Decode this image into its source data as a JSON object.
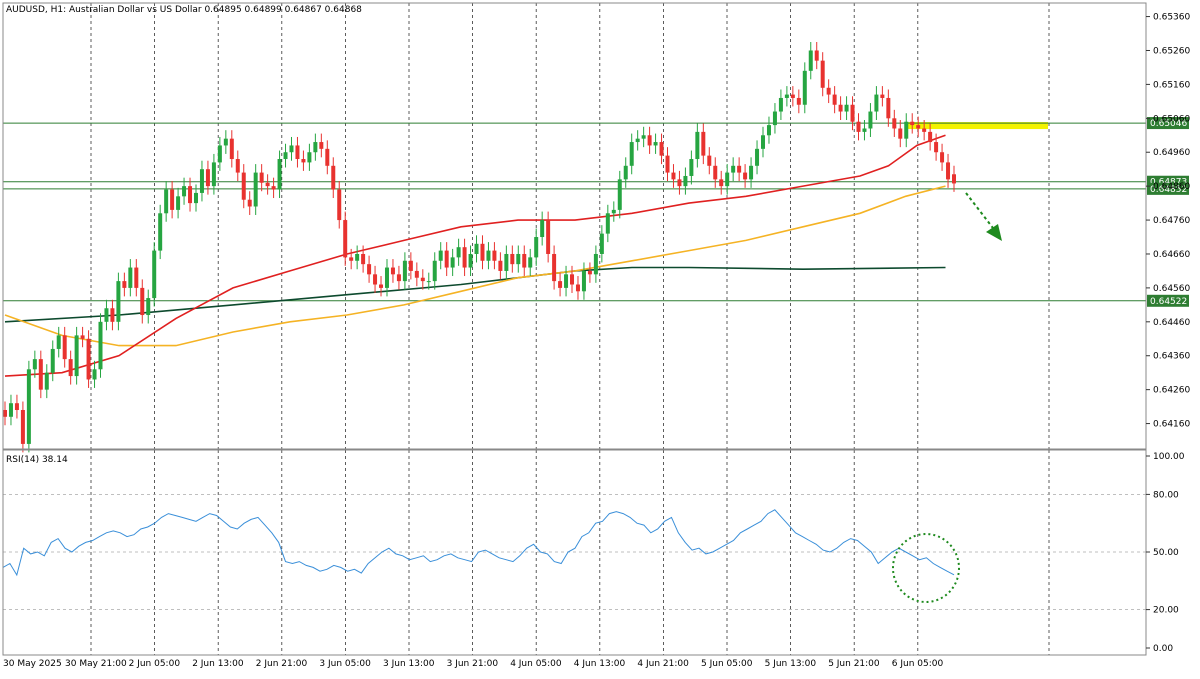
{
  "header": {
    "title": "AUDUSD, H1:  Australian Dollar vs US Dollar  0.64895 0.64899 0.64867 0.64868"
  },
  "rsi_panel": {
    "label": "RSI(14) 38.14"
  },
  "colors": {
    "bull": "#26a541",
    "bear": "#e8322f",
    "ma_red": "#e02020",
    "ma_orange": "#f5b324",
    "ma_dark": "#0d4a2e",
    "rsi": "#3a8fd9",
    "level_line": "#2e7d32",
    "highlight": "#f2f200",
    "price_label_bg": "#2e7d32",
    "arrow": "#1e8a1e"
  },
  "chart_data": {
    "type": "candlestick",
    "symbol": "AUDUSD",
    "timeframe": "H1",
    "ohlc_last": [
      0.64895,
      0.64899,
      0.64867,
      0.64868
    ],
    "y_ticks": [
      "0.65360",
      "0.65260",
      "0.65160",
      "0.65060",
      "0.64960",
      "0.64860",
      "0.64760",
      "0.64660",
      "0.64560",
      "0.64460",
      "0.64360",
      "0.64260",
      "0.64160"
    ],
    "y_range": [
      0.64085,
      0.654
    ],
    "x_labels": [
      "30 May 2025",
      "30 May 21:00",
      "2 Jun 05:00",
      "2 Jun 13:00",
      "2 Jun 21:00",
      "3 Jun 05:00",
      "3 Jun 13:00",
      "3 Jun 21:00",
      "4 Jun 05:00",
      "4 Jun 13:00",
      "4 Jun 21:00",
      "5 Jun 05:00",
      "5 Jun 13:00",
      "5 Jun 21:00",
      "6 Jun 05:00"
    ],
    "x_label_bars": [
      0,
      8,
      16,
      24,
      32,
      40,
      48,
      56,
      64,
      72,
      80,
      88,
      96,
      104,
      112
    ],
    "closes": [
      0.6418,
      0.6422,
      0.642,
      0.641,
      0.6432,
      0.6435,
      0.6426,
      0.6431,
      0.6438,
      0.6442,
      0.6435,
      0.643,
      0.6442,
      0.6441,
      0.6429,
      0.6432,
      0.6446,
      0.645,
      0.6446,
      0.6458,
      0.6456,
      0.6462,
      0.6456,
      0.6448,
      0.6453,
      0.6467,
      0.6478,
      0.6485,
      0.6479,
      0.6483,
      0.6486,
      0.6481,
      0.6484,
      0.6491,
      0.6486,
      0.6493,
      0.6498,
      0.65,
      0.6494,
      0.649,
      0.6482,
      0.648,
      0.649,
      0.6487,
      0.6486,
      0.6485,
      0.6494,
      0.6496,
      0.6498,
      0.6494,
      0.6493,
      0.6496,
      0.6499,
      0.6497,
      0.6492,
      0.6485,
      0.6476,
      0.6465,
      0.6464,
      0.6466,
      0.6463,
      0.646,
      0.6457,
      0.6456,
      0.6462,
      0.646,
      0.6458,
      0.6464,
      0.6461,
      0.6459,
      0.6458,
      0.6458,
      0.6464,
      0.6467,
      0.6462,
      0.6465,
      0.6468,
      0.6462,
      0.6466,
      0.6469,
      0.6464,
      0.6467,
      0.6464,
      0.6461,
      0.6466,
      0.6463,
      0.6466,
      0.6462,
      0.6465,
      0.6471,
      0.6476,
      0.6466,
      0.6458,
      0.6456,
      0.646,
      0.6457,
      0.6455,
      0.6461,
      0.646,
      0.6466,
      0.6472,
      0.6478,
      0.6479,
      0.6488,
      0.6492,
      0.6499,
      0.65,
      0.6501,
      0.6498,
      0.6499,
      0.6495,
      0.649,
      0.6488,
      0.6486,
      0.6489,
      0.6494,
      0.6502,
      0.6495,
      0.6492,
      0.6488,
      0.6486,
      0.649,
      0.6492,
      0.649,
      0.6488,
      0.6492,
      0.6497,
      0.6501,
      0.6504,
      0.6508,
      0.6512,
      0.6513,
      0.6512,
      0.651,
      0.652,
      0.6526,
      0.6523,
      0.6515,
      0.6513,
      0.651,
      0.6508,
      0.651,
      0.6505,
      0.6502,
      0.6503,
      0.6508,
      0.6513,
      0.6512,
      0.6506,
      0.6503,
      0.65,
      0.6505,
      0.6504,
      0.6503,
      0.6502,
      0.6499,
      0.6496,
      0.6493,
      0.6488,
      0.64868
    ],
    "opens": [
      0.642,
      0.6418,
      0.6422,
      0.642,
      0.641,
      0.6432,
      0.6435,
      0.6426,
      0.6431,
      0.6438,
      0.6442,
      0.6435,
      0.643,
      0.6442,
      0.6441,
      0.6429,
      0.6432,
      0.6446,
      0.645,
      0.6446,
      0.6458,
      0.6456,
      0.6462,
      0.6456,
      0.6448,
      0.6453,
      0.6467,
      0.6478,
      0.6485,
      0.6479,
      0.6483,
      0.6486,
      0.6481,
      0.6484,
      0.6491,
      0.6486,
      0.6493,
      0.6498,
      0.65,
      0.6494,
      0.649,
      0.6482,
      0.648,
      0.649,
      0.6487,
      0.6486,
      0.6485,
      0.6494,
      0.6496,
      0.6498,
      0.6494,
      0.6493,
      0.6496,
      0.6499,
      0.6497,
      0.6492,
      0.6485,
      0.6476,
      0.6465,
      0.6464,
      0.6466,
      0.6463,
      0.646,
      0.6457,
      0.6456,
      0.6462,
      0.646,
      0.6458,
      0.6464,
      0.6461,
      0.6459,
      0.6458,
      0.6458,
      0.6464,
      0.6467,
      0.6462,
      0.6465,
      0.6468,
      0.6462,
      0.6466,
      0.6469,
      0.6464,
      0.6467,
      0.6464,
      0.6461,
      0.6466,
      0.6463,
      0.6466,
      0.6462,
      0.6465,
      0.6471,
      0.6476,
      0.6466,
      0.6458,
      0.6456,
      0.646,
      0.6457,
      0.6455,
      0.6461,
      0.646,
      0.6466,
      0.6472,
      0.6478,
      0.6479,
      0.6488,
      0.6492,
      0.6499,
      0.65,
      0.6501,
      0.6498,
      0.6499,
      0.6495,
      0.649,
      0.6488,
      0.6486,
      0.6489,
      0.6494,
      0.6502,
      0.6495,
      0.6492,
      0.6488,
      0.6486,
      0.649,
      0.6492,
      0.649,
      0.6488,
      0.6492,
      0.6497,
      0.6501,
      0.6504,
      0.6508,
      0.6512,
      0.6513,
      0.6512,
      0.651,
      0.652,
      0.6526,
      0.6523,
      0.6515,
      0.6513,
      0.651,
      0.6508,
      0.651,
      0.6505,
      0.6502,
      0.6503,
      0.6508,
      0.6513,
      0.6512,
      0.6506,
      0.6503,
      0.65,
      0.6505,
      0.6504,
      0.6503,
      0.6502,
      0.6499,
      0.6496,
      0.6493,
      0.64895
    ],
    "ma_red": [
      [
        0,
        0.643
      ],
      [
        10,
        0.6431
      ],
      [
        20,
        0.6436
      ],
      [
        30,
        0.6447
      ],
      [
        40,
        0.6456
      ],
      [
        50,
        0.6461
      ],
      [
        60,
        0.6466
      ],
      [
        70,
        0.647
      ],
      [
        80,
        0.6474
      ],
      [
        90,
        0.6476
      ],
      [
        100,
        0.6476
      ],
      [
        110,
        0.6478
      ],
      [
        120,
        0.6481
      ],
      [
        130,
        0.6483
      ],
      [
        140,
        0.6486
      ],
      [
        150,
        0.6489
      ],
      [
        155,
        0.6492
      ],
      [
        160,
        0.6498
      ],
      [
        165,
        0.6501
      ]
    ],
    "ma_orange": [
      [
        0,
        0.6448
      ],
      [
        10,
        0.6442
      ],
      [
        20,
        0.6439
      ],
      [
        30,
        0.6439
      ],
      [
        40,
        0.6443
      ],
      [
        50,
        0.6446
      ],
      [
        60,
        0.6448
      ],
      [
        70,
        0.6451
      ],
      [
        80,
        0.6455
      ],
      [
        90,
        0.6459
      ],
      [
        100,
        0.6461
      ],
      [
        110,
        0.6464
      ],
      [
        120,
        0.6467
      ],
      [
        130,
        0.647
      ],
      [
        140,
        0.6474
      ],
      [
        150,
        0.6478
      ],
      [
        158,
        0.6483
      ],
      [
        165,
        0.6486
      ]
    ],
    "ma_dark": [
      [
        0,
        0.6446
      ],
      [
        20,
        0.6448
      ],
      [
        40,
        0.6451
      ],
      [
        60,
        0.6454
      ],
      [
        80,
        0.6457
      ],
      [
        100,
        0.6461
      ],
      [
        110,
        0.6462
      ],
      [
        120,
        0.6462
      ],
      [
        140,
        0.64615
      ],
      [
        165,
        0.6462
      ]
    ],
    "levels": [
      {
        "price": 0.65046,
        "label": "0.65046"
      },
      {
        "price": 0.64873,
        "label": "0.64873"
      },
      {
        "price": 0.64852,
        "label": "0.64852"
      },
      {
        "price": 0.64522,
        "label": "0.64522"
      }
    ],
    "highlight_zone": {
      "from_bar": 158,
      "to_bar": 185,
      "price_top": 0.65046,
      "price_bottom": 0.6503
    },
    "rsi": {
      "label": "RSI(14) 38.14",
      "y_ticks": [
        "100.00",
        "80.00",
        "50.00",
        "20.00",
        "0.00"
      ],
      "levels": [
        80,
        50,
        20
      ],
      "values": [
        42,
        44,
        38,
        52,
        49,
        50,
        48,
        55,
        57,
        52,
        50,
        53,
        55,
        56,
        58,
        60,
        61,
        60,
        58,
        59,
        62,
        63,
        65,
        68,
        70,
        69,
        68,
        67,
        66,
        68,
        70,
        69,
        66,
        63,
        62,
        65,
        67,
        68,
        64,
        60,
        55,
        45,
        44,
        45,
        43,
        42,
        40,
        41,
        43,
        42,
        40,
        41,
        39,
        44,
        47,
        50,
        52,
        49,
        48,
        46,
        47,
        48,
        45,
        46,
        48,
        49,
        47,
        46,
        45,
        50,
        51,
        49,
        47,
        46,
        45,
        48,
        52,
        54,
        50,
        49,
        45,
        44,
        50,
        52,
        58,
        60,
        65,
        66,
        70,
        71,
        70,
        68,
        65,
        64,
        60,
        62,
        66,
        68,
        60,
        55,
        51,
        52,
        49,
        50,
        52,
        54,
        56,
        60,
        62,
        64,
        66,
        70,
        72,
        68,
        64,
        60,
        58,
        56,
        54,
        51,
        50,
        52,
        55,
        57,
        56,
        53,
        50,
        44,
        47,
        50,
        52,
        50,
        48,
        46,
        47,
        44,
        42,
        40,
        38.14
      ],
      "circle_center_bar": 159,
      "circle_center_value": 44
    }
  }
}
